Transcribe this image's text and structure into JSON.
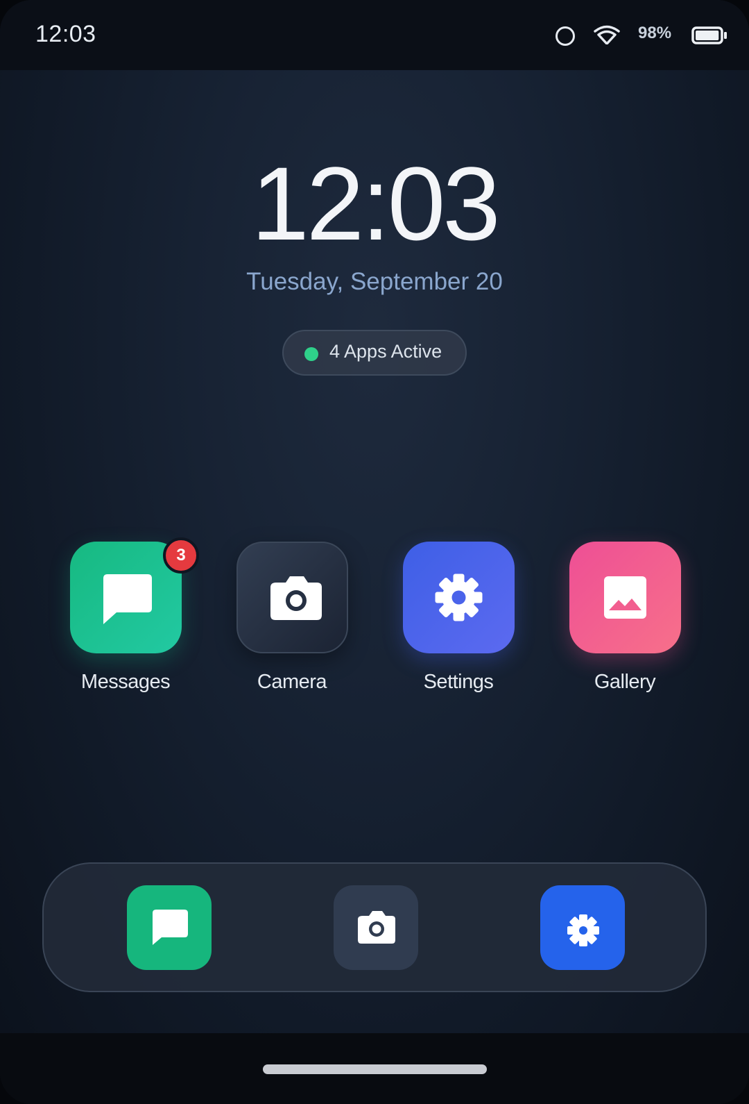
{
  "status_bar": {
    "time": "12:03",
    "battery_percent": "98%",
    "battery_level": 0.98,
    "icons": [
      "ring-icon",
      "wifi-icon",
      "battery-icon"
    ]
  },
  "lock": {
    "clock": "12:03",
    "date": "Tuesday, September 20",
    "active_status": "4 Apps Active",
    "active_dot_color": "#2fd08a"
  },
  "apps": [
    {
      "label": "Messages",
      "icon": "message-bubble-icon",
      "badge": "3",
      "color": "#17b981"
    },
    {
      "label": "Camera",
      "icon": "camera-icon",
      "color": "#2a3445"
    },
    {
      "label": "Settings",
      "icon": "gear-icon",
      "color": "#4a63ea"
    },
    {
      "label": "Gallery",
      "icon": "image-icon",
      "color": "#f25e8f"
    }
  ],
  "dock": {
    "items": [
      {
        "icon": "message-bubble-icon",
        "color": "#16b67d"
      },
      {
        "icon": "camera-icon",
        "color": "#303c50"
      },
      {
        "icon": "gear-icon",
        "color": "#2563eb"
      }
    ]
  }
}
